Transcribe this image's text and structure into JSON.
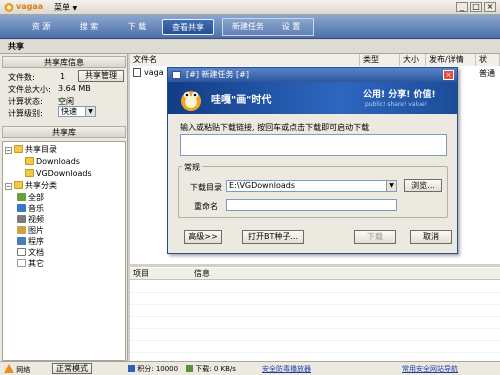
{
  "window": {
    "logo_text": "vagaa",
    "menu_label": "菜单",
    "menu_arrow": "▼",
    "controls": [
      "_",
      "□",
      "×"
    ]
  },
  "nav": {
    "tabs": [
      {
        "label": "资 源"
      },
      {
        "label": "搜 索"
      },
      {
        "label": "下 载"
      },
      {
        "label": "查看共享",
        "active": true
      },
      {
        "label": "新建任务"
      },
      {
        "label": "设 置"
      }
    ]
  },
  "section_title": "共享",
  "library_info": {
    "header": "共享库信息",
    "file_count_label": "文件数:",
    "file_count_value": "1",
    "manage_button": "共享管理",
    "total_size_label": "文件总大小:",
    "total_size_value": "3.64 MB",
    "calc_status_label": "计算状态:",
    "calc_status_value": "空闲",
    "calc_level_label": "计算级别:",
    "calc_level_value": "快速"
  },
  "library_tree": {
    "header": "共享库",
    "dirs_label": "共享目录",
    "dirs": [
      "Downloads",
      "VGDownloads"
    ],
    "categories_label": "共享分类",
    "categories": [
      "全部",
      "音乐",
      "视频",
      "图片",
      "程序",
      "文档",
      "其它"
    ]
  },
  "file_table": {
    "columns": [
      "文件名",
      "类型",
      "大小",
      "发布/详情",
      "状"
    ],
    "rows": [
      {
        "name": "vaga",
        "status": "普通"
      }
    ]
  },
  "details_table": {
    "columns": [
      "项目",
      "信息"
    ]
  },
  "status_bar": {
    "network_label": "网络",
    "mode_button": "正常模式",
    "points": "积分: 10000",
    "download_speed": "下载: 0 KB/s",
    "antivirus_link": "安全防毒播放器",
    "nav_link": "常用安全网站导航"
  },
  "dialog": {
    "title": "[#] 新建任务 [#]",
    "banner_title": "哇嘎\"画\"时代",
    "banner_slogan": "公用! 分享! 价值!",
    "banner_sub": "public! share! value!",
    "hint": "输入或粘贴下载链接, 按回车或点击下载即可启动下载",
    "url_value": "",
    "group_label": "常规",
    "dir_label": "下载目录",
    "dir_value": "E:\\VGDownloads",
    "browse_button": "浏览...",
    "rename_label": "重命名",
    "rename_value": "",
    "advanced_button": "高级>>",
    "torrent_button": "打开BT种子...",
    "download_button": "下载",
    "cancel_button": "取消"
  }
}
